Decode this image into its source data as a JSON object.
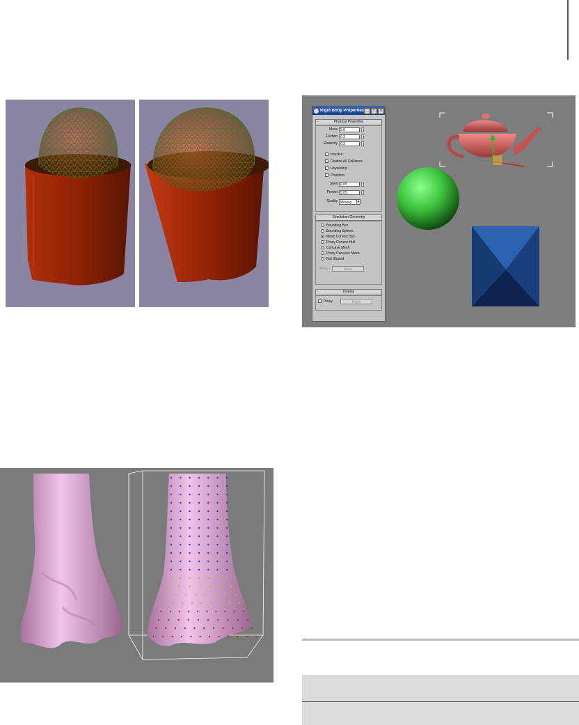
{
  "dialog": {
    "title": "Rigid Body Properties",
    "minimize": "_",
    "maximize": "□",
    "close": "×",
    "physical": {
      "header": "Physical Properties",
      "collapse": "-",
      "mass_label": "Mass",
      "mass_value": "5.0",
      "friction_label": "Friction",
      "friction_value": "0.3",
      "elasticity_label": "Elasticity",
      "elasticity_value": "0.3",
      "inactive": "Inactive",
      "disable_collisions": "Disable All Collisions",
      "unyielding": "Unyielding",
      "phantom": "Phantom",
      "shell_label": "Shell",
      "shell_value": "0.05",
      "prewet_label": "Prewet",
      "prewet_value": "0.05",
      "quality_label": "Quality",
      "quality_value": "Moving",
      "quality_arrow": "▾"
    },
    "simulation": {
      "header": "Simulation Geometry",
      "collapse": "-",
      "options": [
        "Bounding Box",
        "Bounding Sphere",
        "Mesh Convex Hull",
        "Proxy Convex Hull",
        "Concave Mesh",
        "Proxy Concave Mesh",
        "Not Shared"
      ],
      "selected_index": 2,
      "proxy_label": "Proxy",
      "proxy_button": "None"
    },
    "display": {
      "header": "Display",
      "collapse": "-",
      "proxy_label": "Proxy",
      "proxy_button": "None"
    }
  },
  "colors": {
    "pot": "#9a2a0a",
    "sphere": "#3ec43e",
    "teapot": "#d0605e",
    "pyramid": "#1e4f9a",
    "leg": "#d9a7d1",
    "viewport_bg": "#7d7d7d",
    "pot_bg": "#8b85a3"
  }
}
